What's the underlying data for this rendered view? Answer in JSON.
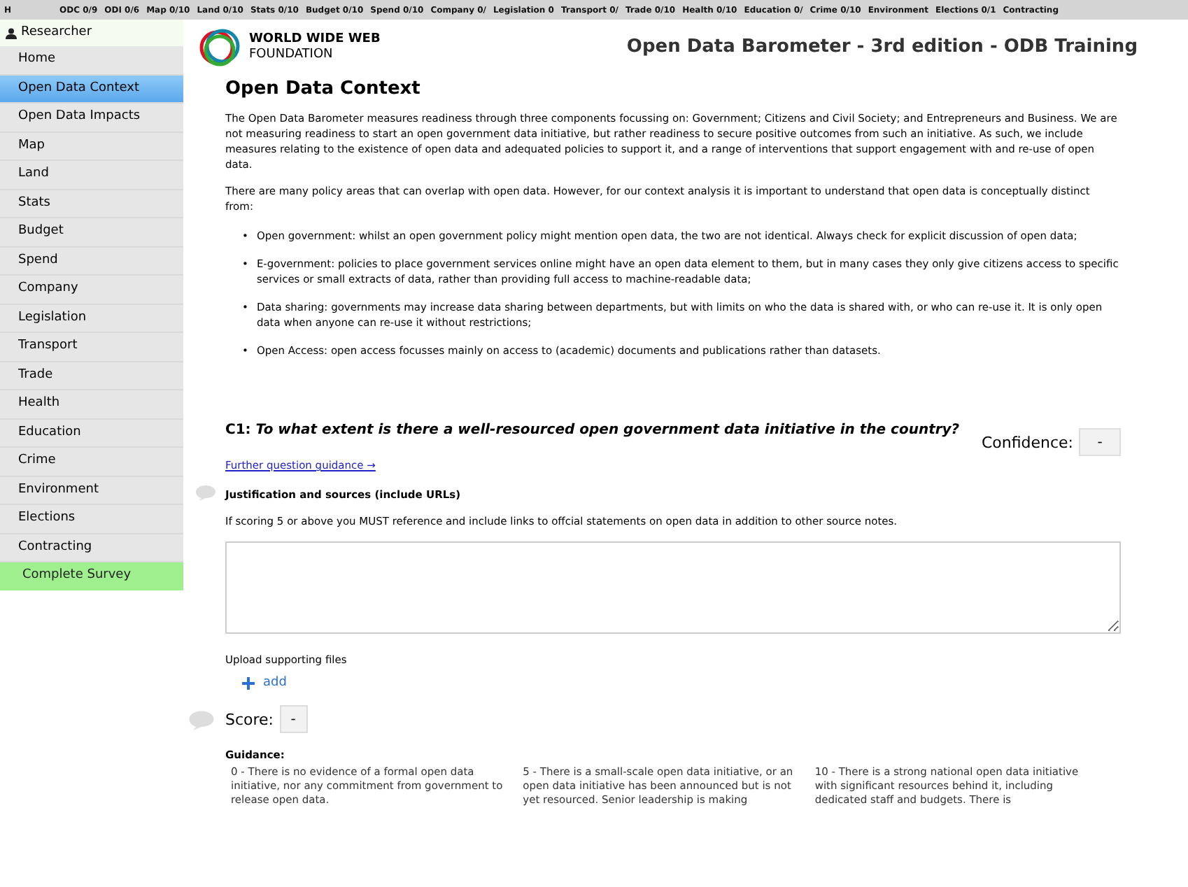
{
  "progress_bar": [
    {
      "label": "H"
    },
    {
      "label": "ODC 0/9"
    },
    {
      "label": "ODI 0/6"
    },
    {
      "label": "Map 0/10"
    },
    {
      "label": "Land 0/10"
    },
    {
      "label": "Stats 0/10"
    },
    {
      "label": "Budget 0/10"
    },
    {
      "label": "Spend 0/10"
    },
    {
      "label": "Company 0/"
    },
    {
      "label": "Legislation 0"
    },
    {
      "label": "Transport 0/"
    },
    {
      "label": "Trade 0/10"
    },
    {
      "label": "Health 0/10"
    },
    {
      "label": "Education 0/"
    },
    {
      "label": "Crime 0/10"
    },
    {
      "label": "Environment"
    },
    {
      "label": "Elections 0/1"
    },
    {
      "label": "Contracting"
    }
  ],
  "sidebar": {
    "user": "Researcher",
    "items": [
      {
        "label": "Home",
        "selected": false,
        "kind": "nav"
      },
      {
        "label": "Open Data Context",
        "selected": true,
        "kind": "nav"
      },
      {
        "label": "Open Data Impacts",
        "selected": false,
        "kind": "nav"
      },
      {
        "label": "Map",
        "selected": false,
        "kind": "nav"
      },
      {
        "label": "Land",
        "selected": false,
        "kind": "nav"
      },
      {
        "label": "Stats",
        "selected": false,
        "kind": "nav"
      },
      {
        "label": "Budget",
        "selected": false,
        "kind": "nav"
      },
      {
        "label": "Spend",
        "selected": false,
        "kind": "nav"
      },
      {
        "label": "Company",
        "selected": false,
        "kind": "nav"
      },
      {
        "label": "Legislation",
        "selected": false,
        "kind": "nav"
      },
      {
        "label": "Transport",
        "selected": false,
        "kind": "nav"
      },
      {
        "label": "Trade",
        "selected": false,
        "kind": "nav"
      },
      {
        "label": "Health",
        "selected": false,
        "kind": "nav"
      },
      {
        "label": "Education",
        "selected": false,
        "kind": "nav"
      },
      {
        "label": "Crime",
        "selected": false,
        "kind": "nav"
      },
      {
        "label": "Environment",
        "selected": false,
        "kind": "nav"
      },
      {
        "label": "Elections",
        "selected": false,
        "kind": "nav"
      },
      {
        "label": "Contracting",
        "selected": false,
        "kind": "nav"
      },
      {
        "label": "Complete Survey",
        "selected": false,
        "kind": "action"
      }
    ]
  },
  "header": {
    "logo_line1": "WORLD WIDE WEB",
    "logo_line2": "FOUNDATION",
    "title": "Open Data Barometer - 3rd edition - ODB Training"
  },
  "section": {
    "heading": "Open Data Context",
    "paragraphs": [
      "The Open Data Barometer measures readiness through three components focussing on: Government; Citizens and Civil Society; and Entrepreneurs and Business. We are not measuring readiness to start an open government data initiative, but rather readiness to secure positive outcomes from such an initiative. As such, we include measures relating to the existence of open data and adequated policies to support it, and a range of interventions that support engagement with and re-use of open data.",
      "There are many policy areas that can overlap with open data. However, for our context analysis it is important to understand that open data is conceptually distinct from:"
    ],
    "bullets": [
      {
        "marker": "•",
        "text": "Open government: whilst an open government policy might mention open data, the two are not identical. Always check for explicit discussion of open data;"
      },
      {
        "marker": "•",
        "text": "E-government: policies to place government services online might have an open data element to them, but in many cases they only give citizens access to specific services or small extracts of data, rather than providing full access to machine-readable data;"
      },
      {
        "marker": "•",
        "text": "Data sharing: governments may increase data sharing between departments, but with limits on who the data is shared with, or who can re-use it. It is only open data when anyone can re-use it without restrictions;"
      },
      {
        "marker": "•",
        "text": "Open Access: open access focusses mainly on access to (academic) documents and publications rather than datasets."
      }
    ]
  },
  "question": {
    "number": "C1:",
    "text": "To what extent is there a well-resourced open government data initiative in the country?",
    "confidence_label": "Confidence:",
    "confidence_value": "-",
    "guidance_link": "Further question guidance →",
    "justification_label": "Justification and sources (include URLs)",
    "justification_hint": "If scoring 5 or above you MUST reference and include links to offcial statements on open data in addition to other source notes.",
    "upload_label": "Upload supporting files",
    "add_label": "add",
    "score_label": "Score:",
    "score_value": "-",
    "guidance_heading": "Guidance:",
    "guidance": [
      "0 - There is no evidence of a formal open data initiative, nor any commitment from government to release open data.",
      "5 - There is a small-scale open data initiative, or an open data initiative has been announced but is not yet resourced. Senior leadership is making",
      "10 - There is a strong national open data initiative with significant resources behind it, including dedicated staff and budgets. There is"
    ]
  }
}
